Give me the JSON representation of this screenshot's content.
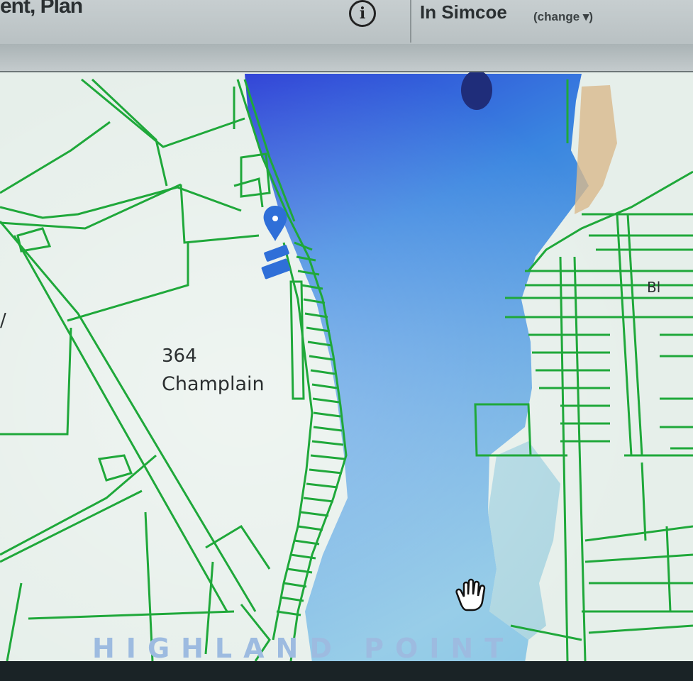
{
  "header": {
    "title_fragment": "ent, Plan",
    "info_symbol": "i",
    "location": "In Simcoe",
    "change_link": "(change ▾)"
  },
  "map": {
    "parcel_number": "364",
    "road_name": "Champlain",
    "area_label": "HIGHLAND POINT",
    "edge_label_right": "Bl",
    "edge_label_left": "/",
    "colors": {
      "water": "#3a86e0",
      "land": "#e6efea",
      "parcel_lines": "#1fa83a",
      "marker": "#2f6fd8"
    },
    "icons": [
      "location-pin-icon",
      "hand-cursor-icon"
    ]
  }
}
